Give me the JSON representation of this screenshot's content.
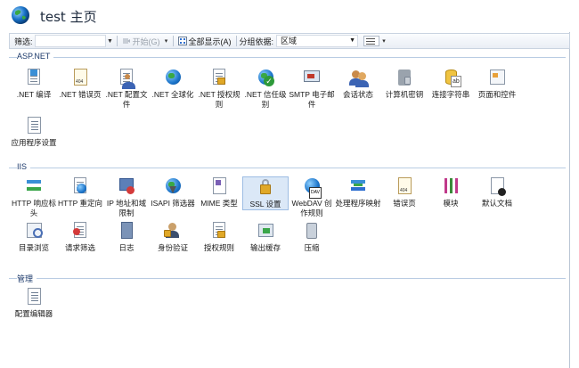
{
  "header": {
    "title": "test 主页"
  },
  "toolbar": {
    "filter_label": "筛选:",
    "filter_value": "",
    "start_label": "开始(G)",
    "show_all_label": "全部显示(A)",
    "group_label": "分组依据:",
    "group_value": "区域"
  },
  "sections": [
    {
      "label": "ASP.NET",
      "items": [
        {
          "label": ".NET 编译",
          "icon": "download-doc-icon"
        },
        {
          "label": ".NET 错误页",
          "icon": "error-page-icon"
        },
        {
          "label": ".NET 配置文件",
          "icon": "profile-icon"
        },
        {
          "label": ".NET 全球化",
          "icon": "globe-icon"
        },
        {
          "label": ".NET 授权规则",
          "icon": "lock-icon"
        },
        {
          "label": ".NET 信任级别",
          "icon": "trust-check-icon"
        },
        {
          "label": "SMTP 电子邮件",
          "icon": "mail-icon"
        },
        {
          "label": "会话状态",
          "icon": "people-icon"
        },
        {
          "label": "计算机密钥",
          "icon": "key-icon"
        },
        {
          "label": "连接字符串",
          "icon": "database-icon"
        },
        {
          "label": "页面和控件",
          "icon": "page-controls-icon"
        },
        {
          "label": "应用程序设置",
          "icon": "app-settings-icon"
        }
      ]
    },
    {
      "label": "IIS",
      "items": [
        {
          "label": "HTTP 响应标头",
          "icon": "response-headers-icon"
        },
        {
          "label": "HTTP 重定向",
          "icon": "redirect-icon"
        },
        {
          "label": "IP 地址和域限制",
          "icon": "ip-restrict-icon"
        },
        {
          "label": "ISAPI 筛选器",
          "icon": "isapi-globe-icon"
        },
        {
          "label": "MIME 类型",
          "icon": "mime-icon"
        },
        {
          "label": "SSL 设置",
          "icon": "ssl-lock-icon"
        },
        {
          "label": "WebDAV 创作规则",
          "icon": "webdav-icon"
        },
        {
          "label": "处理程序映射",
          "icon": "handler-mapping-icon"
        },
        {
          "label": "错误页",
          "icon": "error-404-icon"
        },
        {
          "label": "模块",
          "icon": "modules-icon"
        },
        {
          "label": "默认文档",
          "icon": "default-doc-icon"
        },
        {
          "label": "目录浏览",
          "icon": "directory-browse-icon"
        },
        {
          "label": "请求筛选",
          "icon": "request-filter-icon"
        },
        {
          "label": "日志",
          "icon": "log-icon"
        },
        {
          "label": "身份验证",
          "icon": "auth-icon"
        },
        {
          "label": "授权规则",
          "icon": "authorization-icon"
        },
        {
          "label": "输出缓存",
          "icon": "output-cache-icon"
        },
        {
          "label": "压缩",
          "icon": "compression-icon"
        }
      ]
    },
    {
      "label": "管理",
      "items": [
        {
          "label": "配置编辑器",
          "icon": "config-editor-icon"
        }
      ]
    }
  ]
}
